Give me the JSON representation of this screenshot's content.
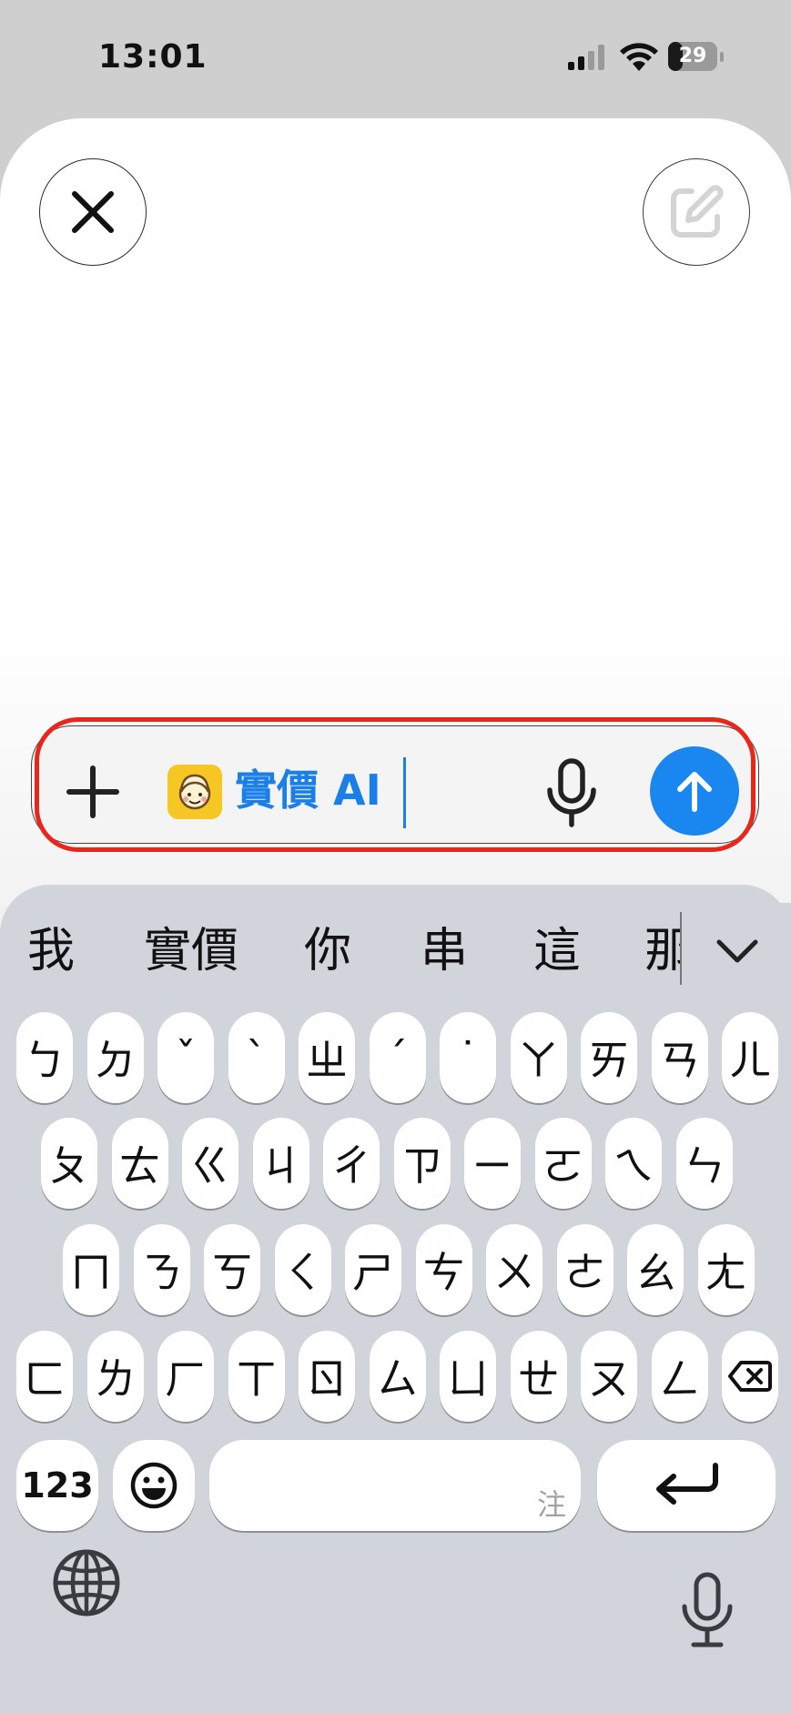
{
  "status_bar": {
    "time": "13:01",
    "battery_level": "29",
    "battery_fraction": 0.29
  },
  "input": {
    "chip_text": "實價 AI",
    "chip_icon": "face-emoji-icon",
    "accent_color": "#1a87f0",
    "highlight_color": "#e8261c"
  },
  "keyboard": {
    "candidates": [
      "我",
      "實價",
      "你",
      "串",
      "這",
      "那"
    ],
    "rows": [
      [
        "ㄅ",
        "ㄉ",
        "ˇ",
        "ˋ",
        "ㄓ",
        "ˊ",
        "˙",
        "ㄚ",
        "ㄞ",
        "ㄢ",
        "ㄦ"
      ],
      [
        "ㄆ",
        "ㄊ",
        "ㄍ",
        "ㄐ",
        "ㄔ",
        "ㄗ",
        "ㄧ",
        "ㄛ",
        "ㄟ",
        "ㄣ"
      ],
      [
        "ㄇ",
        "ㄋ",
        "ㄎ",
        "ㄑ",
        "ㄕ",
        "ㄘ",
        "ㄨ",
        "ㄜ",
        "ㄠ",
        "ㄤ"
      ],
      [
        "ㄈ",
        "ㄌ",
        "ㄏ",
        "ㄒ",
        "ㄖ",
        "ㄙ",
        "ㄩ",
        "ㄝ",
        "ㄡ",
        "ㄥ"
      ]
    ],
    "numbers_label": "123",
    "space_hint": "注"
  }
}
